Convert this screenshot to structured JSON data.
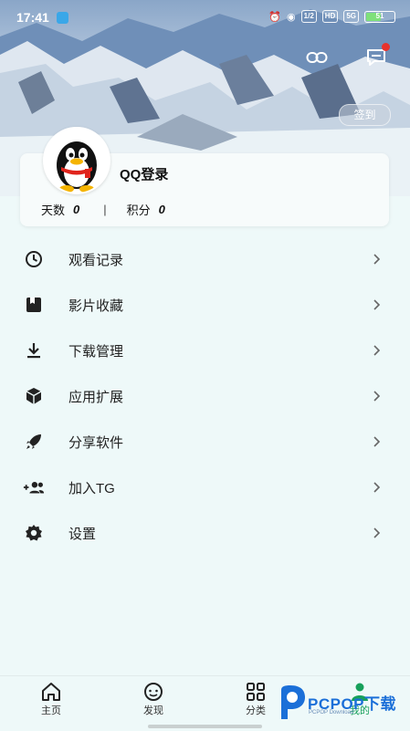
{
  "status_bar": {
    "time": "17:41",
    "network_chip_1": "1/2",
    "network_chip_2": "HD",
    "network_chip_3": "5G",
    "battery_level": "51"
  },
  "header": {
    "sign_in_button": "签到"
  },
  "profile": {
    "username": "QQ登录",
    "days_label": "天数",
    "days_value": "0",
    "points_label": "积分",
    "points_value": "0"
  },
  "menu": {
    "items": [
      {
        "label": "观看记录",
        "icon": "clock-icon"
      },
      {
        "label": "影片收藏",
        "icon": "bookmark-icon"
      },
      {
        "label": "下载管理",
        "icon": "download-icon"
      },
      {
        "label": "应用扩展",
        "icon": "cube-icon"
      },
      {
        "label": "分享软件",
        "icon": "rocket-icon"
      },
      {
        "label": "加入TG",
        "icon": "group-add-icon"
      },
      {
        "label": "设置",
        "icon": "gear-icon"
      }
    ]
  },
  "bottom_nav": {
    "items": [
      {
        "label": "主页",
        "icon": "home-icon"
      },
      {
        "label": "发现",
        "icon": "discover-icon"
      },
      {
        "label": "分类",
        "icon": "grid-icon"
      },
      {
        "label": "我的",
        "icon": "profile-icon"
      }
    ],
    "active": "我的"
  },
  "watermark": {
    "text": "PCPOP下载",
    "subtext": "PCPOP Download"
  },
  "colors": {
    "background": "#eef9f9",
    "active_tab": "#17a05b",
    "notification_dot": "#e8322c",
    "watermark_blue": "#1b6fd8"
  }
}
